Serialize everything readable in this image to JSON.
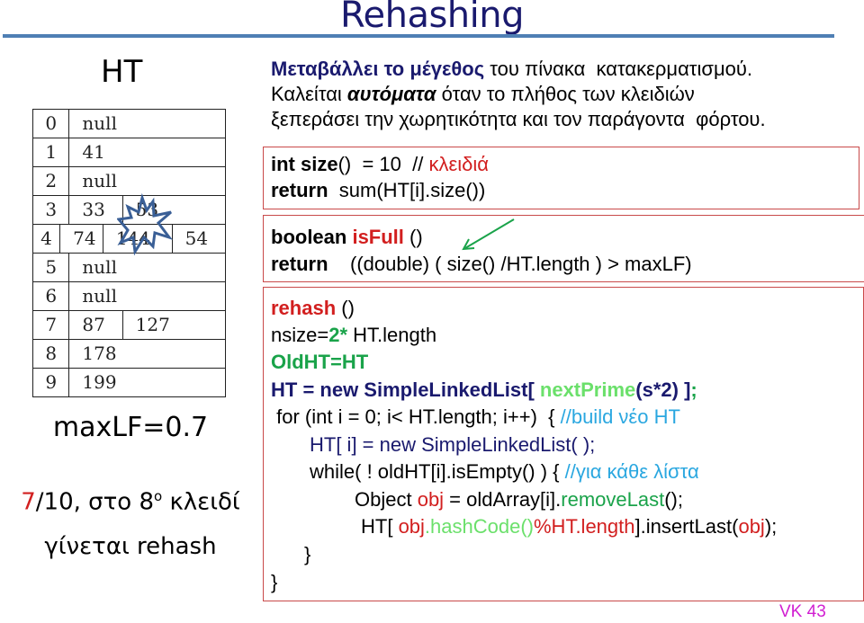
{
  "header": {
    "title": "Rehashing"
  },
  "left": {
    "ht_label": "HT",
    "table": [
      {
        "index": "0",
        "cells": [
          "null"
        ]
      },
      {
        "index": "1",
        "cells": [
          "41"
        ]
      },
      {
        "index": "2",
        "cells": [
          "null"
        ]
      },
      {
        "index": "3",
        "cells": [
          "33",
          "53"
        ]
      },
      {
        "index": "4",
        "cells": [
          "74",
          "144",
          "54"
        ]
      },
      {
        "index": "5",
        "cells": [
          "null"
        ]
      },
      {
        "index": "6",
        "cells": [
          "null"
        ]
      },
      {
        "index": "7",
        "cells": [
          "87",
          "127"
        ]
      },
      {
        "index": "8",
        "cells": [
          "178"
        ]
      },
      {
        "index": "9",
        "cells": [
          "199"
        ]
      }
    ],
    "maxlf": "maxLF=0.7",
    "note_red": "7",
    "note_rest": "/10, στο 8",
    "note_sup": "ο",
    "note_tail": " κλειδί",
    "note_line2": "γίνεται rehash"
  },
  "intro": {
    "l1_bold": "Μεταβάλλει το μέγεθος",
    "l1_rest": " του πίνακα  κατακερματισμού.",
    "l2_a": "Καλείται ",
    "l2_b": "αυτόματα",
    "l2_c": " όταν το πλήθος των κλειδιών",
    "l3": "ξεπεράσει την χωρητικότητα και τον παράγοντα  φόρτου."
  },
  "size_box": {
    "l1_a": "int size",
    "l1_b": "()  = 10  // ",
    "l1_c": "κλειδιά",
    "l2_a": "return",
    "l2_b": "  sum(HT[i].size())"
  },
  "isfull_box": {
    "l1_a": "boolean ",
    "l1_b": "isFull",
    "l1_c": " ()",
    "l2_a": "return",
    "l2_b": "    ((double) ( size() /HT.length ) > maxLF)"
  },
  "rehash_box": {
    "l1_a": "rehash",
    "l1_b": " ()",
    "l2_a": "nsize=",
    "l2_b": "2*",
    "l2_c": " HT.length",
    "l3": "OldHT=HT",
    "l4_a": "HT = new SimpleLinkedList[ ",
    "l4_b": "nextPrime",
    "l4_c": "(s*2) ]",
    "l4_d": ";",
    "l5_a": " for (int i = 0; i< HT.length; i++)  { ",
    "l5_b": "//build νέο HT",
    "l6": "HT[ i] = new SimpleLinkedList( );",
    "l7_a": "while( ! oldHT[i].isEmpty() ) { ",
    "l7_b": "//για κάθε λίστα",
    "l8_a": "Object ",
    "l8_b": "obj",
    "l8_c": " = oldArray[i].",
    "l8_d": "removeLast",
    "l8_e": "();",
    "l9_a": "HT[ ",
    "l9_b": "obj",
    "l9_c": ".hashCode()",
    "l9_d": "%HT.length",
    "l9_e": "].insertLast(",
    "l9_f": "obj",
    "l9_g": ");",
    "l10": "}",
    "l11": "}"
  },
  "footer": {
    "slide_label": "VK 43"
  }
}
